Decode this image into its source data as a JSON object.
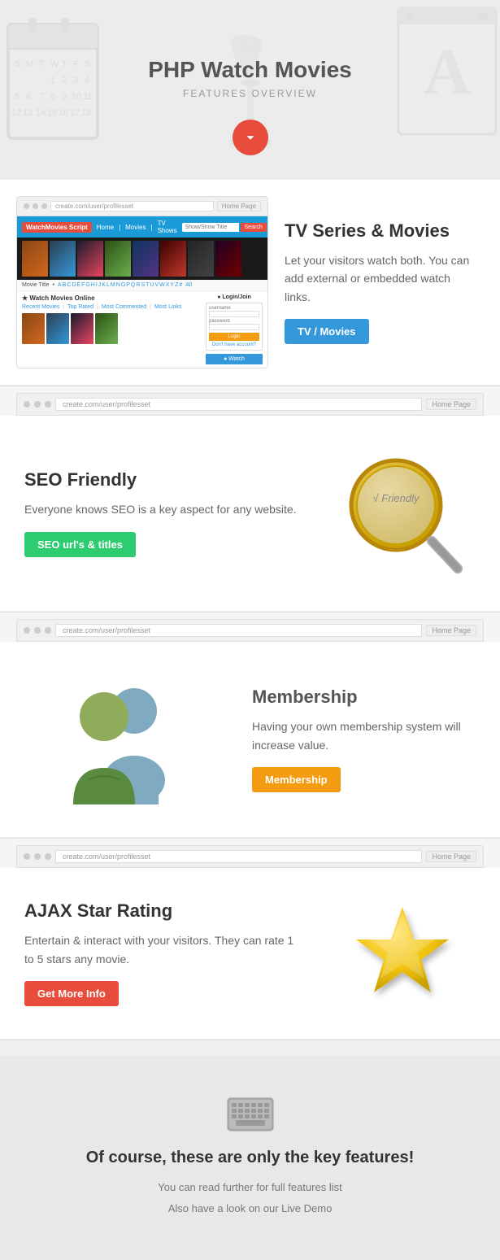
{
  "hero": {
    "title": "PHP Watch Movies",
    "subtitle": "FEATURES OVERVIEW",
    "scroll_btn_label": "↓"
  },
  "sections": {
    "tv_movies": {
      "title": "TV Series & Movies",
      "description": "Let your visitors watch both. You can add external or embedded watch links.",
      "btn_label": "TV / Movies",
      "btn_color": "#3498db"
    },
    "seo": {
      "title": "SEO Friendly",
      "description": "Everyone knows SEO is a key aspect for any website.",
      "btn_label": "SEO url's & titles",
      "btn_color": "#2ecc71",
      "magnify_text": "√ Friendly"
    },
    "membership": {
      "title": "Membership",
      "description": "Having your own membership system will increase value.",
      "btn_label": "Membership",
      "btn_color": "#f39c12"
    },
    "ajax_rating": {
      "title": "AJAX Star Rating",
      "description": "Entertain & interact with your visitors. They can rate 1 to 5 stars any movie.",
      "btn_label": "Get More Info",
      "btn_color": "#e74c3c"
    }
  },
  "bottom": {
    "icon": "⌨",
    "title": "Of course, these are only the key features!",
    "line1": "You can read further for full features list",
    "line2": "Also have a look on our Live Demo"
  },
  "browser": {
    "url": "create.com/user/profilesset",
    "nav_label": "Home Page"
  },
  "movie_site": {
    "logo": "WatchMovies Script",
    "nav_items": [
      "Home",
      "Movies",
      "TV Shows"
    ],
    "search_placeholder": "Show/Show Title",
    "search_btn": "Search",
    "alphabet": [
      "A",
      "B",
      "C",
      "D",
      "E",
      "F",
      "G",
      "H",
      "I",
      "J",
      "K",
      "L",
      "M",
      "N",
      "O",
      "P",
      "Q",
      "R",
      "S",
      "T",
      "U",
      "V",
      "W",
      "X",
      "Y",
      "Z"
    ],
    "tabs": [
      "Recent Movies",
      "Top Rated",
      "Most Commented",
      "Most Links"
    ],
    "login_label": "Login/Join",
    "watch_label": "Watch"
  }
}
